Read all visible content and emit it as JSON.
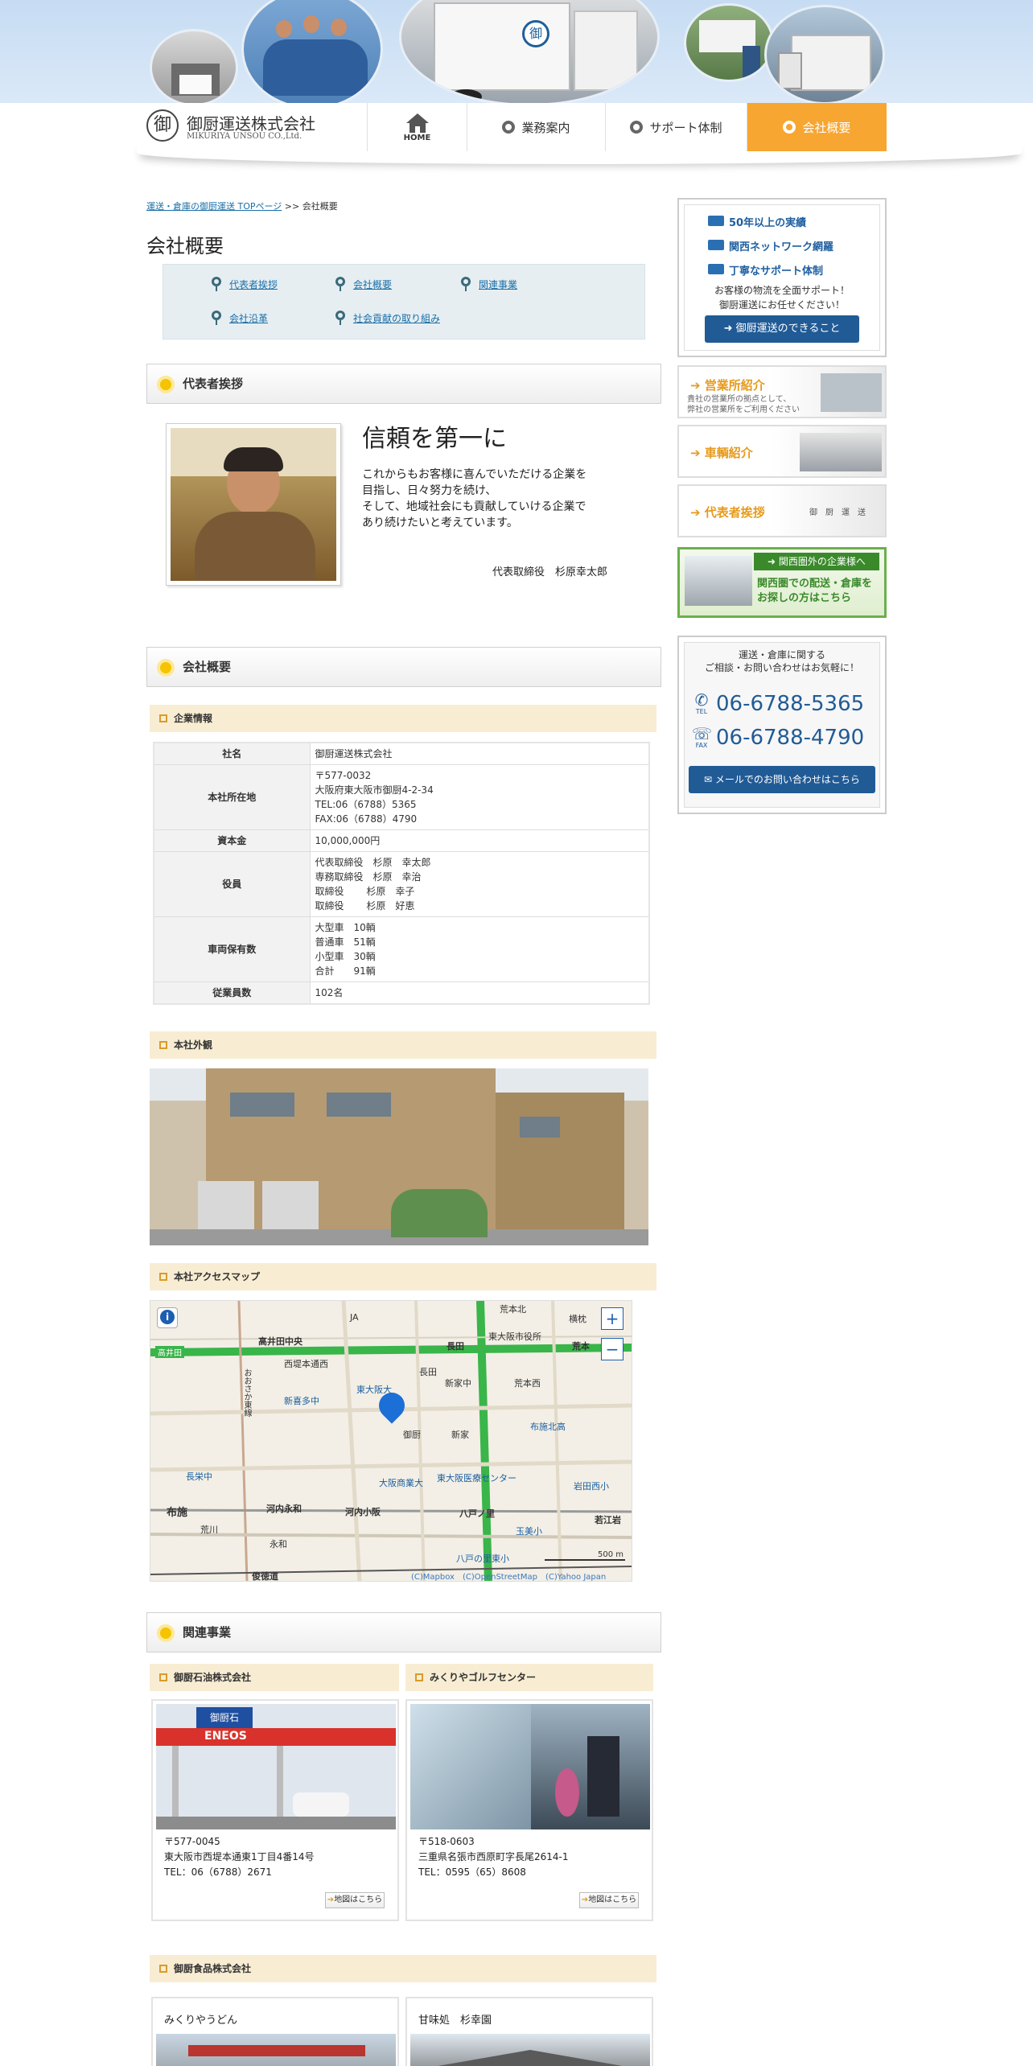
{
  "header": {
    "company_name": "御厨運送株式会社",
    "company_name_en": "MIKURIYA UNSOU CO.,Ltd.",
    "logo_mark": "御",
    "truck_label": "御"
  },
  "nav": {
    "items": [
      {
        "label": "HOME",
        "icon": "home-icon"
      },
      {
        "label": "業務案内"
      },
      {
        "label": "サポート体制"
      },
      {
        "label": "会社概要"
      }
    ]
  },
  "breadcrumb": {
    "link": "運送・倉庫の御厨運送 TOPページ",
    "sep": ">>",
    "current": "会社概要"
  },
  "page_title": "会社概要",
  "subnav": [
    "代表者挨拶",
    "会社概要",
    "関連事業",
    "会社沿革",
    "社会貢献の取り組み"
  ],
  "greeting": {
    "heading": "代表者挨拶",
    "catch": "信頼を第一に",
    "message": "これからもお客様に喜んでいただける企業を目指し、日々努力を続け、そして、地域社会にも貢献していける企業であり続けたいと考えています。",
    "lines": [
      "これからもお客様に喜んでいただける企業を",
      "目指し、日々努力を続け、",
      "そして、地域社会にも貢献していける企業で",
      "あり続けたいと考えています。"
    ],
    "signature": "代表取締役　杉原幸太郎"
  },
  "overview": {
    "heading": "会社概要",
    "company_info_heading": "企業情報",
    "rows": [
      {
        "label": "社名",
        "lines": [
          "御厨運送株式会社"
        ]
      },
      {
        "label": "本社所在地",
        "lines": [
          "〒577-0032",
          "大阪府東大阪市御厨4-2-34",
          "TEL:06（6788）5365",
          "FAX:06（6788）4790"
        ]
      },
      {
        "label": "資本金",
        "lines": [
          "10,000,000円"
        ]
      },
      {
        "label": "役員",
        "lines": [
          "代表取締役　杉原　幸太郎",
          "専務取締役　杉原　幸治",
          "取締役　　 杉原　幸子",
          "取締役　　 杉原　好恵"
        ]
      },
      {
        "label": "車両保有数",
        "lines": [
          "大型車　10輌",
          "普通車　51輌",
          "小型車　30輌",
          "合計　　91輌"
        ]
      },
      {
        "label": "従業員数",
        "lines": [
          "102名"
        ]
      }
    ],
    "exterior_heading": "本社外観",
    "map_heading": "本社アクセスマップ"
  },
  "map": {
    "labels": [
      "高井田中央",
      "長田",
      "荒本",
      "高井田",
      "西堤本通西",
      "東大阪市役所",
      "荒本北",
      "横枕",
      "JA",
      "新喜多中",
      "東大阪大",
      "荒本西",
      "新家中",
      "長田",
      "布施北高",
      "御厨",
      "新家",
      "長栄中",
      "大阪商業大",
      "東大阪医療センター",
      "岩田西小",
      "河内永和",
      "河内小阪",
      "八戸ノ里",
      "若江岩",
      "布施",
      "荒川",
      "永和",
      "玉美小",
      "八戸の里東小",
      "俊徳道",
      "おおさか東線"
    ],
    "scale": "500 m",
    "credits": "(C)Mapbox　(C)OpenStreetMap　(C)Yahoo Japan",
    "zoom_in": "+",
    "zoom_out": "−",
    "info": "i"
  },
  "related": {
    "heading": "関連事業",
    "companies": [
      {
        "name": "御厨石油株式会社",
        "lines": [
          "〒577-0045",
          "東大阪市西堤本通東1丁目4番14号",
          "TEL：06（6788）2671"
        ],
        "map_link": "地図はこちら",
        "sign1": "御厨石",
        "sign2": "ENEOS"
      },
      {
        "name": "みくりやゴルフセンター",
        "lines": [
          "〒518-0603",
          "三重県名張市西原町字長尾2614-1",
          "TEL：0595（65）8608"
        ],
        "map_link": "地図はこちら"
      }
    ],
    "food_heading": "御厨食品株式会社",
    "food_shops": [
      "みくりやうどん",
      "甘味処　杉幸園"
    ]
  },
  "sidebar": {
    "features": [
      "50年以上の実績",
      "関西ネットワーク網羅",
      "丁寧なサポート体制"
    ],
    "feature_text": [
      "お客様の物流を全面サポート！",
      "御厨運送にお任せください！"
    ],
    "feature_button": "御厨運送のできること",
    "banners": [
      {
        "label": "営業所紹介",
        "sub1": "貴社の営業所の拠点として、",
        "sub2": "弊社の営業所をご利用ください"
      },
      {
        "label": "車輌紹介"
      },
      {
        "label": "代表者挨拶",
        "sub1": "御　厨　運　送"
      }
    ],
    "kansai_banner": {
      "top": "関西圏外の企業様へ",
      "l1": "関西圏での配送・倉庫を",
      "l2": "お探しの方はこちら"
    },
    "contact": {
      "intro1": "運送・倉庫に関する",
      "intro2": "ご相談・お問い合わせはお気軽に！",
      "tel_tag": "TEL",
      "fax_tag": "FAX",
      "tel": "06-6788-5365",
      "fax": "06-6788-4790",
      "mail_button": "メールでのお問い合わせはこちら"
    }
  },
  "colors": {
    "accent": "#f6a631",
    "link": "#1a6fa8",
    "navy": "#215b96",
    "cream": "#f8edd3"
  }
}
